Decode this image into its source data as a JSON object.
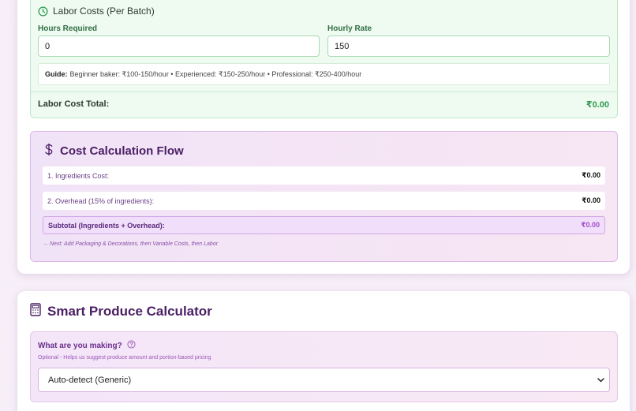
{
  "labor": {
    "title": "Labor Costs (Per Batch)",
    "hours_label": "Hours Required",
    "hours_value": "0",
    "rate_label": "Hourly Rate",
    "rate_value": "150",
    "guide_label": "Guide:",
    "guide_text": "Beginner baker: ₹100-150/hour • Experienced: ₹150-250/hour • Professional: ₹250-400/hour",
    "total_label": "Labor Cost Total:",
    "total_value": "₹0.00",
    "accent": "#2e9a4f"
  },
  "flow": {
    "title": "Cost Calculation Flow",
    "rows": [
      {
        "label": "1. Ingredients Cost:",
        "value": "₹0.00"
      },
      {
        "label": "2. Overhead (15% of ingredients):",
        "value": "₹0.00"
      }
    ],
    "subtotal_label": "Subtotal (Ingredients + Overhead):",
    "subtotal_value": "₹0.00",
    "note": "→ Next: Add Packaging & Decorations, then Variable Costs, then Labor",
    "accent": "#4a1e64"
  },
  "smart": {
    "title": "Smart Produce Calculator",
    "making_label": "What are you making?",
    "hint": "Optional - Helps us suggest produce amount and portion-based pricing",
    "select_value": "Auto-detect (Generic)",
    "icon": "calculator-icon"
  }
}
